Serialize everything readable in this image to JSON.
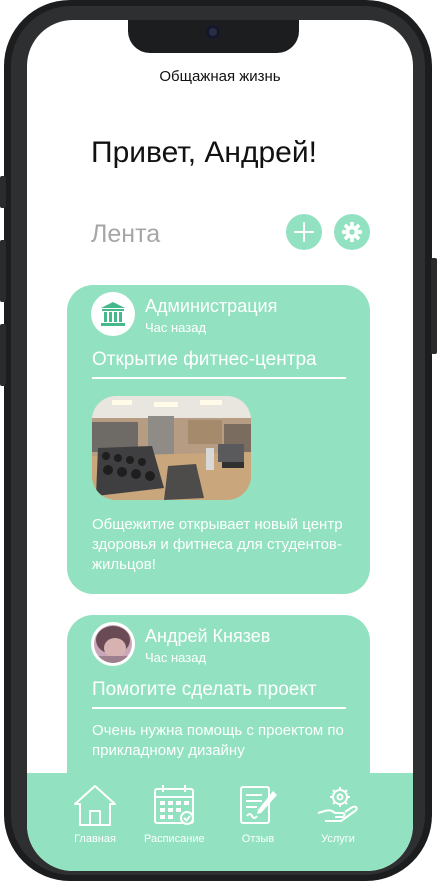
{
  "app": {
    "title": "Общажная жизнь"
  },
  "greeting": "Привет, Андрей!",
  "feed": {
    "heading": "Лента"
  },
  "colors": {
    "accent": "#92e2c1",
    "card_text": "#ffffff",
    "heading_gray": "#a6a6a6"
  },
  "icons": {
    "add": "plus-icon",
    "settings": "gear-icon",
    "admin_avatar": "institution-building-icon",
    "home": "house-icon",
    "schedule": "calendar-icon",
    "feedback": "notepad-pencil-icon",
    "services": "hand-gear-icon"
  },
  "posts": [
    {
      "author": "Администрация",
      "time": "Час назад",
      "title": "Открытие фитнес-центра",
      "text": "Общежитие открывает новый центр здоровья и фитнеса для студентов-жильцов!"
    },
    {
      "author": "Андрей Князев",
      "time": "Час назад",
      "title": "Помогите сделать проект",
      "text": "Очень нужна помощь с проектом по прикладному дизайну"
    }
  ],
  "tabs": [
    {
      "label": "Главная"
    },
    {
      "label": "Расписание"
    },
    {
      "label": "Отзыв"
    },
    {
      "label": "Услуги"
    }
  ]
}
